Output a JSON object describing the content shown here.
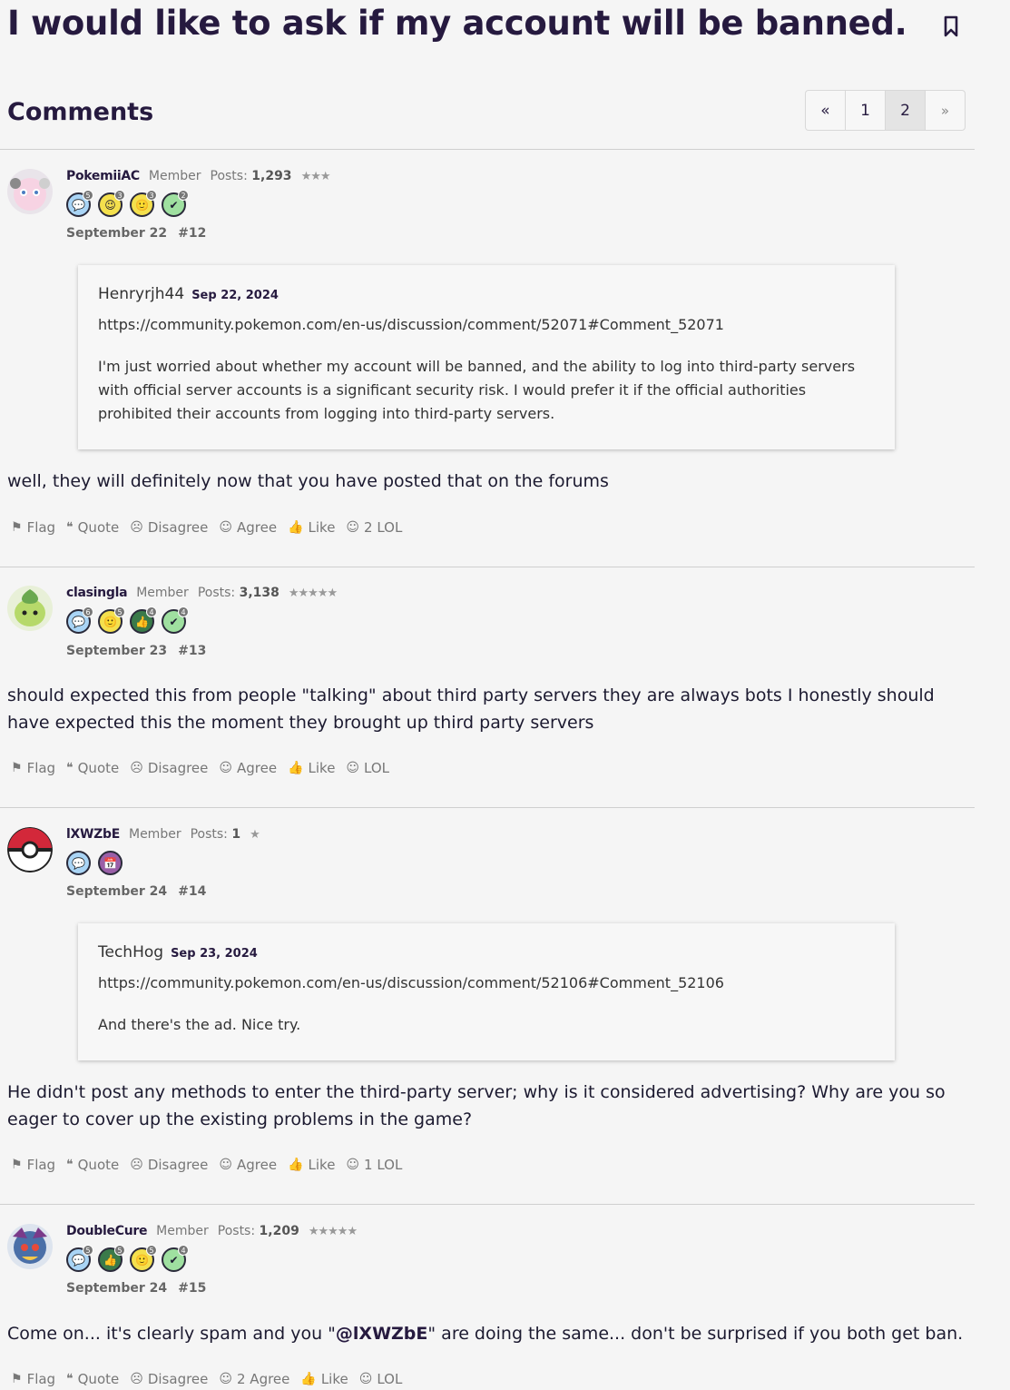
{
  "thread": {
    "title": "I would like to ask if my account will be banned.",
    "comments_heading": "Comments"
  },
  "pager": {
    "prev": "«",
    "pages": [
      "1",
      "2"
    ],
    "current": "2",
    "next": "»"
  },
  "comments": [
    {
      "author": "PokemiiAC",
      "role": "Member",
      "posts_label": "Posts:",
      "posts": "1,293",
      "stars": "★★★",
      "badges": [
        {
          "icon": "speech-bubble-icon",
          "count": "5",
          "color": "#a9d4f5"
        },
        {
          "icon": "wink-face-icon",
          "count": "3",
          "color": "#f4e04d"
        },
        {
          "icon": "smile-face-icon",
          "count": "3",
          "color": "#f4e04d"
        },
        {
          "icon": "check-icon",
          "count": "2",
          "color": "#9fe0a0"
        }
      ],
      "date": "September 22",
      "number": "#12",
      "quote": {
        "author": "Henryrjh44",
        "date": "Sep 22, 2024",
        "link": "https://community.pokemon.com/en-us/discussion/comment/52071#Comment_52071",
        "text": "I'm just worried about whether my account will be banned, and the ability to log into third-party servers with official server accounts is a significant security risk. I would prefer it if the official authorities prohibited their accounts from logging into third-party servers."
      },
      "body": "well, they will definitely now that you have posted that on the forums",
      "actions": [
        "Flag",
        "Quote",
        "Disagree",
        "Agree",
        "Like",
        "2 LOL"
      ]
    },
    {
      "author": "clasingla",
      "role": "Member",
      "posts_label": "Posts:",
      "posts": "3,138",
      "stars": "★★★★★",
      "badges": [
        {
          "icon": "speech-bubble-icon",
          "count": "6",
          "color": "#a9d4f5"
        },
        {
          "icon": "smile-face-icon",
          "count": "5",
          "color": "#f4e04d"
        },
        {
          "icon": "thumbs-up-icon",
          "count": "4",
          "color": "#3a7a4a"
        },
        {
          "icon": "check-icon",
          "count": "4",
          "color": "#9fe0a0"
        }
      ],
      "date": "September 23",
      "number": "#13",
      "body": "should expected this from people \"talking\" about third party servers they are always bots I honestly should have expected this the moment they brought up third party servers",
      "actions": [
        "Flag",
        "Quote",
        "Disagree",
        "Agree",
        "Like",
        "LOL"
      ]
    },
    {
      "author": "lXWZbE",
      "role": "Member",
      "posts_label": "Posts:",
      "posts": "1",
      "stars": "★",
      "badges": [
        {
          "icon": "speech-bubble-icon",
          "count": "",
          "color": "#a9d4f5"
        },
        {
          "icon": "calendar-icon",
          "count": "",
          "color": "#9a5fa8"
        }
      ],
      "date": "September 24",
      "number": "#14",
      "quote": {
        "author": "TechHog",
        "date": "Sep 23, 2024",
        "link": "https://community.pokemon.com/en-us/discussion/comment/52106#Comment_52106",
        "text": "And there's the ad. Nice try."
      },
      "body": "He didn't post any methods to enter the third-party server; why is it considered advertising? Why are you so eager to cover up the existing problems in the game?",
      "actions": [
        "Flag",
        "Quote",
        "Disagree",
        "Agree",
        "Like",
        "1 LOL"
      ]
    },
    {
      "author": "DoubleCure",
      "role": "Member",
      "posts_label": "Posts:",
      "posts": "1,209",
      "stars": "★★★★★",
      "badges": [
        {
          "icon": "speech-bubble-icon",
          "count": "5",
          "color": "#a9d4f5"
        },
        {
          "icon": "thumbs-up-icon",
          "count": "5",
          "color": "#3a7a4a"
        },
        {
          "icon": "smile-face-icon",
          "count": "5",
          "color": "#f4e04d"
        },
        {
          "icon": "check-icon",
          "count": "4",
          "color": "#9fe0a0"
        }
      ],
      "date": "September 24",
      "number": "#15",
      "body_pre": "Come on... it's clearly spam and you \"",
      "body_mention": "@lXWZbE",
      "body_post": "\" are doing the same... don't be surprised if you both get ban.",
      "actions": [
        "Flag",
        "Quote",
        "Disagree",
        "2 Agree",
        "Like",
        "LOL"
      ]
    }
  ]
}
